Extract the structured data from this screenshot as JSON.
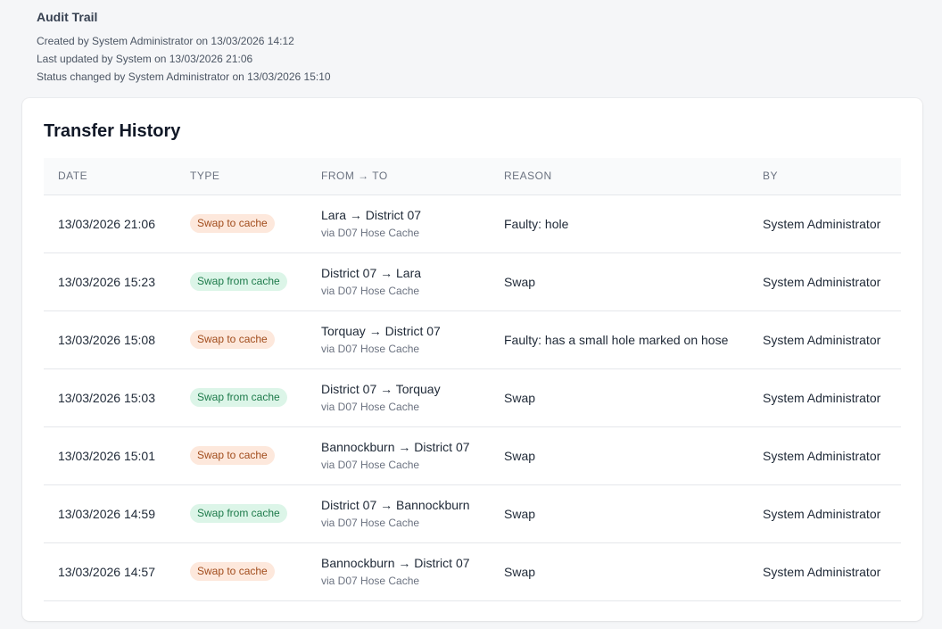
{
  "audit": {
    "title": "Audit Trail",
    "lines": [
      "Created by System Administrator on 13/03/2026 14:12",
      "Last updated by System on 13/03/2026 21:06",
      "Status changed by System Administrator on 13/03/2026 15:10"
    ]
  },
  "transfers": {
    "title": "Transfer History",
    "columns": [
      "DATE",
      "TYPE",
      "FROM → TO",
      "REASON",
      "BY"
    ],
    "rows": [
      {
        "date": "13/03/2026 21:06",
        "type": "Swap to cache",
        "kind": "to",
        "route": "Lara → District 07",
        "via": "via D07 Hose Cache",
        "reason": "Faulty: hole",
        "by": "System Administrator"
      },
      {
        "date": "13/03/2026 15:23",
        "type": "Swap from cache",
        "kind": "from",
        "route": "District 07 → Lara",
        "via": "via D07 Hose Cache",
        "reason": "Swap",
        "by": "System Administrator"
      },
      {
        "date": "13/03/2026 15:08",
        "type": "Swap to cache",
        "kind": "to",
        "route": "Torquay → District 07",
        "via": "via D07 Hose Cache",
        "reason": "Faulty: has a small hole marked on hose",
        "by": "System Administrator"
      },
      {
        "date": "13/03/2026 15:03",
        "type": "Swap from cache",
        "kind": "from",
        "route": "District 07 → Torquay",
        "via": "via D07 Hose Cache",
        "reason": "Swap",
        "by": "System Administrator"
      },
      {
        "date": "13/03/2026 15:01",
        "type": "Swap to cache",
        "kind": "to",
        "route": "Bannockburn → District 07",
        "via": "via D07 Hose Cache",
        "reason": "Swap",
        "by": "System Administrator"
      },
      {
        "date": "13/03/2026 14:59",
        "type": "Swap from cache",
        "kind": "from",
        "route": "District 07 → Bannockburn",
        "via": "via D07 Hose Cache",
        "reason": "Swap",
        "by": "System Administrator"
      },
      {
        "date": "13/03/2026 14:57",
        "type": "Swap to cache",
        "kind": "to",
        "route": "Bannockburn → District 07",
        "via": "via D07 Hose Cache",
        "reason": "Swap",
        "by": "System Administrator"
      }
    ]
  },
  "colors": {
    "badge_to_bg": "#fde8dc",
    "badge_to_text": "#a14c1c",
    "badge_from_bg": "#dcf5e8",
    "badge_from_text": "#1d7a4a"
  }
}
